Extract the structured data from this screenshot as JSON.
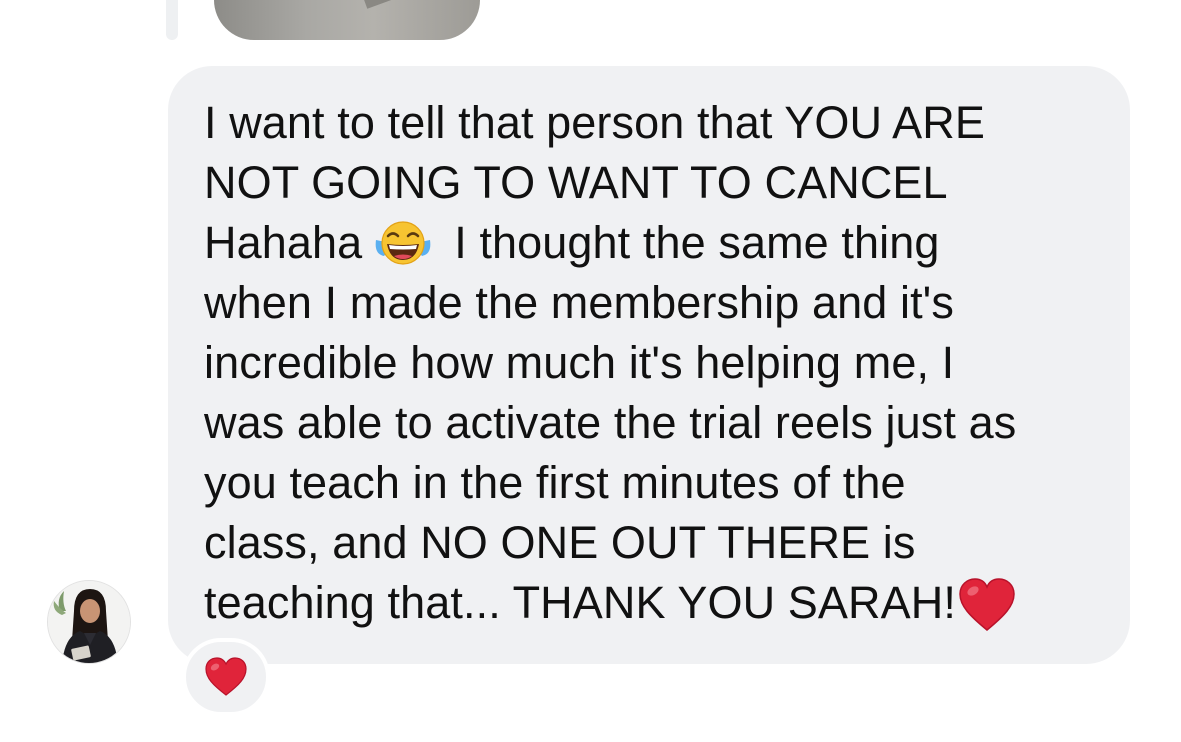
{
  "message": {
    "lines": [
      "I want to tell that person that YOU ARE",
      "NOT GOING TO WANT TO CANCEL",
      "Hahaha",
      "I thought the same thing",
      "when I made the membership and it's",
      "incredible how much it's helping me, I",
      "was able to activate the trial reels just as",
      "you teach in the first minutes of the",
      "class, and NO ONE OUT THERE is",
      "teaching that... THANK YOU SARAH!"
    ],
    "emojis": {
      "laugh": "face-with-tears-of-joy-icon",
      "heart": "red-heart-icon"
    }
  },
  "reaction": {
    "icon": "red-heart-icon",
    "color": "#e0243a"
  },
  "sender": {
    "avatar_icon": "avatar"
  },
  "colors": {
    "bubble": "#f0f1f3",
    "text": "#111111",
    "heart": "#e0243a"
  }
}
